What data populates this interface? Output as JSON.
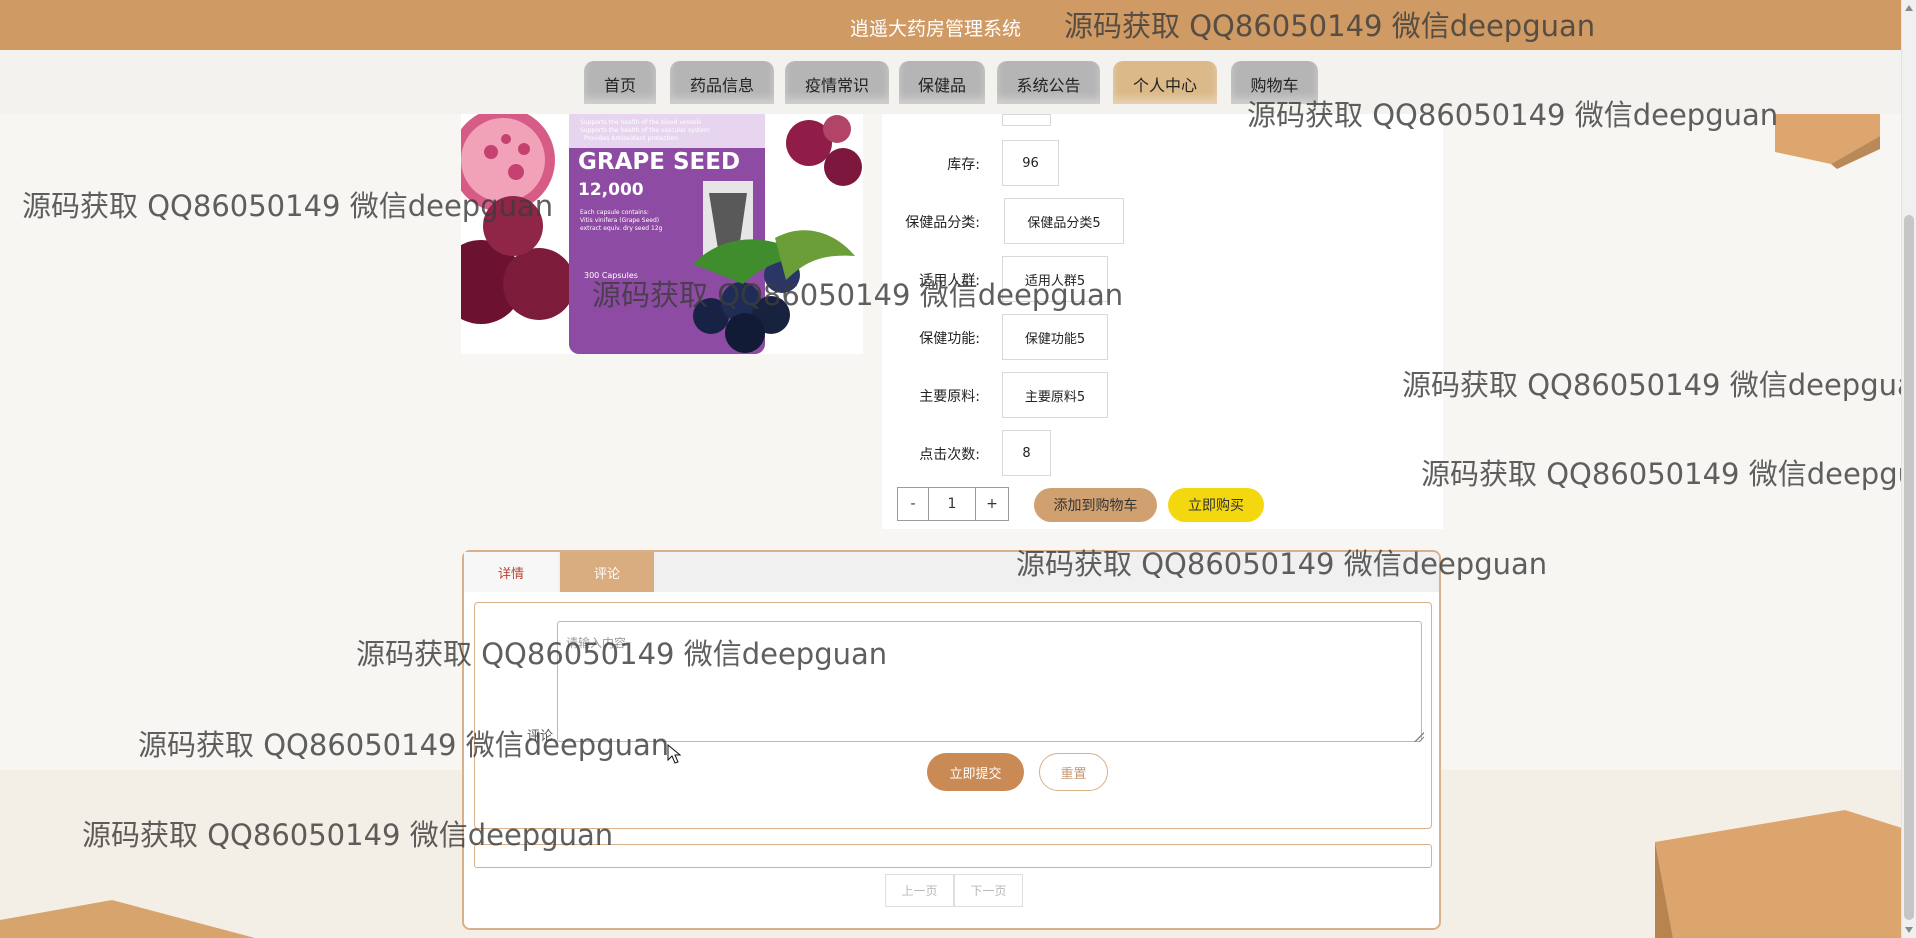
{
  "header": {
    "title": "逍遥大药房管理系统"
  },
  "nav": [
    {
      "label": "首页",
      "active": false
    },
    {
      "label": "药品信息",
      "active": false
    },
    {
      "label": "疫情常识",
      "active": false
    },
    {
      "label": "保健品",
      "active": false
    },
    {
      "label": "系统公告",
      "active": false
    },
    {
      "label": "个人中心",
      "active": true
    },
    {
      "label": "购物车",
      "active": false
    }
  ],
  "product": {
    "image_text": {
      "line1": "Supports the health of the blood vessels",
      "line2": "Supports the health of the vascular system",
      "line3": "Provides Antioxidant protection",
      "brand": "GRAPE SEED",
      "count": "12,000",
      "small1": "Each capsule contains:",
      "small2": "Vitis vinifera (Grape Seed)",
      "small3": "extract equiv. dry seed 12g",
      "capsules": "300 Capsules"
    },
    "fields": [
      {
        "label": "库存:",
        "value": "96"
      },
      {
        "label": "保健品分类:",
        "value": "保健品分类5"
      },
      {
        "label": "适用人群:",
        "value": "适用人群5"
      },
      {
        "label": "保健功能:",
        "value": "保健功能5"
      },
      {
        "label": "主要原料:",
        "value": "主要原料5"
      },
      {
        "label": "点击次数:",
        "value": "8"
      }
    ],
    "quantity": {
      "minus": "-",
      "value": "1",
      "plus": "+"
    },
    "buttons": {
      "add_to_cart": "添加到购物车",
      "buy_now": "立即购买"
    }
  },
  "tabs": {
    "detail": "详情",
    "comment": "评论"
  },
  "comment_form": {
    "label": "评论",
    "placeholder": "请输入内容",
    "submit": "立即提交",
    "reset": "重置"
  },
  "pagination": {
    "prev": "上一页",
    "next": "下一页"
  },
  "watermark": "源码获取 QQ86050149 微信deepguan",
  "colors": {
    "topbar": "#cf9a63",
    "nav_active": "#dbb988",
    "nav_default": "#b5b5b5",
    "cart_button": "#d1a071",
    "buy_button": "#f4d80f",
    "panel_border": "#d8b08b"
  }
}
